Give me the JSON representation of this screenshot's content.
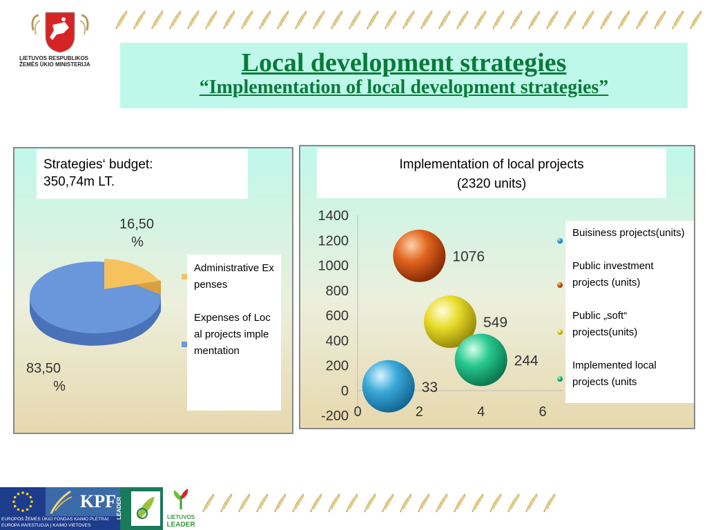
{
  "header": {
    "title": "Local development strategies",
    "subtitle": "“Implementation of local development strategies”",
    "ministry_line1": "LIETUVOS RESPUBLIKOS",
    "ministry_line2": "ŽEMĖS ŪKIO MINISTERIJA"
  },
  "left_panel": {
    "budget_line1": "Strategies‘ budget:",
    "budget_line2": "350,74m LT.",
    "legend_admin": "Administrative Expenses",
    "legend_local": "Expenses of Local projects implementation"
  },
  "right_panel": {
    "title_line1": "Implementation of local projects",
    "title_line2": "(2320 units)",
    "legend": [
      "Buisiness projects(units)",
      "Public investment projects (units)",
      "Public „soft“ projects(units)",
      "Implemented local projects (units"
    ]
  },
  "footer": {
    "eu_line1": "EUROPOS ŽEMĖS ŪKIO FONDAS KAIMO PLĖTRAI:",
    "eu_line2": "EUROPA INVESTUOJA Į KAIMO VIETOVES",
    "kpf": "KPF",
    "leader_vertical": "LEADER",
    "lietuvos": "LIETUVOS",
    "leader": "LEADER"
  },
  "colors": {
    "title_green": "#0a7a3a",
    "admin": "#f6c25e",
    "local": "#6a96dc",
    "business": "#3aa8d8",
    "public_investment": "#e0641e",
    "soft": "#e8dc2a",
    "implemented": "#28c890"
  },
  "chart_data": [
    {
      "type": "pie",
      "labels": [
        "16,50 %",
        "83,50 %"
      ],
      "slices": [
        {
          "name": "Administrative Expenses",
          "value": 16.5
        },
        {
          "name": "Expenses of Local projects implementation",
          "value": 83.5
        }
      ]
    },
    {
      "type": "scatter",
      "subtype": "bubble",
      "yticks": [
        "1400",
        "1200",
        "1000",
        "800",
        "600",
        "400",
        "200",
        "0",
        "-200"
      ],
      "xticks": [
        "0",
        "2",
        "4",
        "6"
      ],
      "xlim": [
        0,
        6
      ],
      "ylim": [
        -200,
        1400
      ],
      "series": [
        {
          "name": "Buisiness projects(units)",
          "x": 1,
          "y": 33,
          "label": "33"
        },
        {
          "name": "Public investment projects (units)",
          "x": 2,
          "y": 1076,
          "label": "1076"
        },
        {
          "name": "Public „soft“ projects(units)",
          "x": 3,
          "y": 549,
          "label": "549"
        },
        {
          "name": "Implemented local projects (units",
          "x": 4,
          "y": 244,
          "label": "244"
        }
      ]
    }
  ]
}
